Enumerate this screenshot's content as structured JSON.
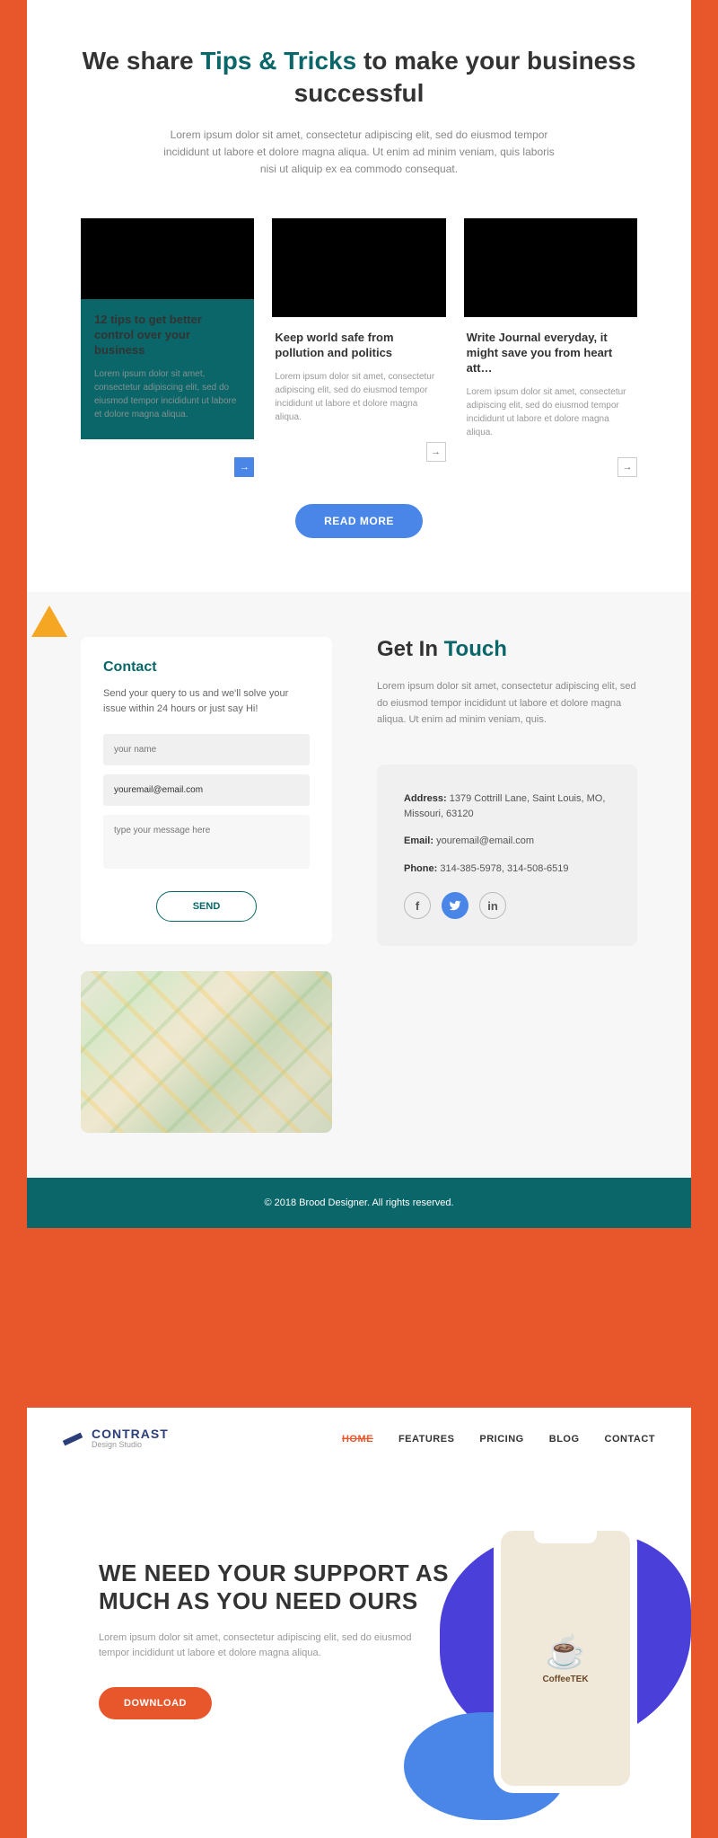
{
  "tips": {
    "title_pre": "We share ",
    "title_highlight": "Tips & Tricks",
    "title_post": " to make your business successful",
    "desc": "Lorem ipsum dolor sit amet, consectetur adipiscing elit, sed do eiusmod tempor incididunt ut labore et dolore magna aliqua. Ut enim ad minim veniam, quis  laboris nisi ut aliquip ex ea commodo consequat.",
    "cards": [
      {
        "title": "12 tips to get better control over your business",
        "text": "Lorem ipsum dolor sit amet, consectetur adipiscing elit, sed do eiusmod tempor incididunt ut labore et dolore magna aliqua."
      },
      {
        "title": "Keep world safe from pollution and politics",
        "text": "Lorem ipsum dolor sit amet, consectetur adipiscing elit, sed do eiusmod tempor incididunt ut labore et dolore magna aliqua."
      },
      {
        "title": "Write Journal everyday, it might save you from heart att…",
        "text": "Lorem ipsum dolor sit amet, consectetur adipiscing elit, sed do eiusmod tempor incididunt ut labore et dolore magna aliqua."
      }
    ],
    "readmore": "READ MORE"
  },
  "contact": {
    "heading": "Contact",
    "desc": "Send your query to us and we'll solve your issue within 24 hours or just say Hi!",
    "name_placeholder": "your name",
    "email_value": "youremail@email.com",
    "message_placeholder": "type your message here",
    "send": "SEND"
  },
  "touch": {
    "title_pre": "Get In ",
    "title_highlight": "Touch",
    "desc": "Lorem ipsum dolor sit amet, consectetur adipiscing elit, sed do eiusmod tempor incididunt ut labore et dolore magna aliqua. Ut enim ad minim veniam, quis.",
    "address_label": "Address:",
    "address": " 1379 Cottrill Lane, Saint Louis, MO, Missouri, 63120",
    "email_label": "Email:",
    "email": " youremail@email.com",
    "phone_label": "Phone:",
    "phone": " 314-385-5978, 314-508-6519"
  },
  "footer1": "© 2018 Brood Designer. All rights reserved.",
  "nav": {
    "brand": "CONTRAST",
    "sub": "Design Studio",
    "links": [
      "HOME",
      "FEATURES",
      "PRICING",
      "BLOG",
      "CONTACT"
    ]
  },
  "hero": {
    "title": "WE NEED YOUR SUPPORT AS MUCH AS YOU NEED OURS",
    "desc": "Lorem ipsum dolor sit amet, consectetur adipiscing elit, sed do eiusmod tempor incididunt ut labore et dolore magna aliqua.",
    "cta": "DOWNLOAD",
    "app": "CoffeeTEK"
  }
}
